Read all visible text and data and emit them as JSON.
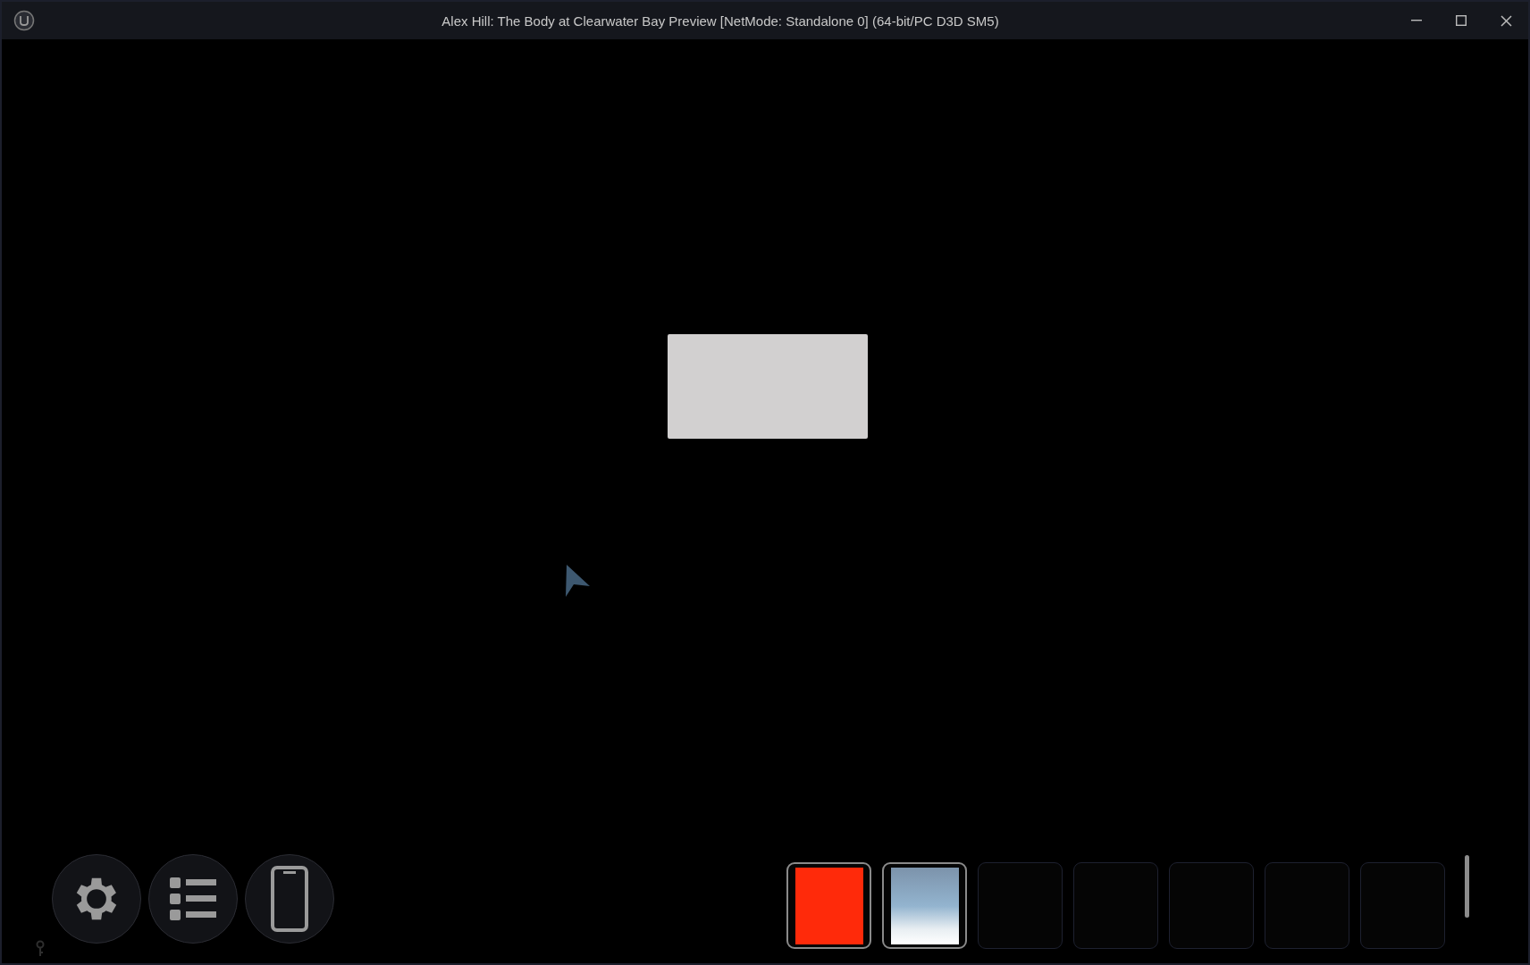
{
  "window": {
    "title": "Alex Hill: The Body at Clearwater Bay Preview [NetMode: Standalone 0]  (64-bit/PC D3D SM5)"
  },
  "menu_buttons": [
    {
      "kind": "settings"
    },
    {
      "kind": "list"
    },
    {
      "kind": "phone"
    }
  ],
  "inventory": [
    {
      "kind": "color",
      "color": "#ff2a0a"
    },
    {
      "kind": "image"
    },
    {
      "kind": "empty"
    },
    {
      "kind": "empty"
    },
    {
      "kind": "empty"
    },
    {
      "kind": "empty"
    },
    {
      "kind": "empty"
    }
  ]
}
